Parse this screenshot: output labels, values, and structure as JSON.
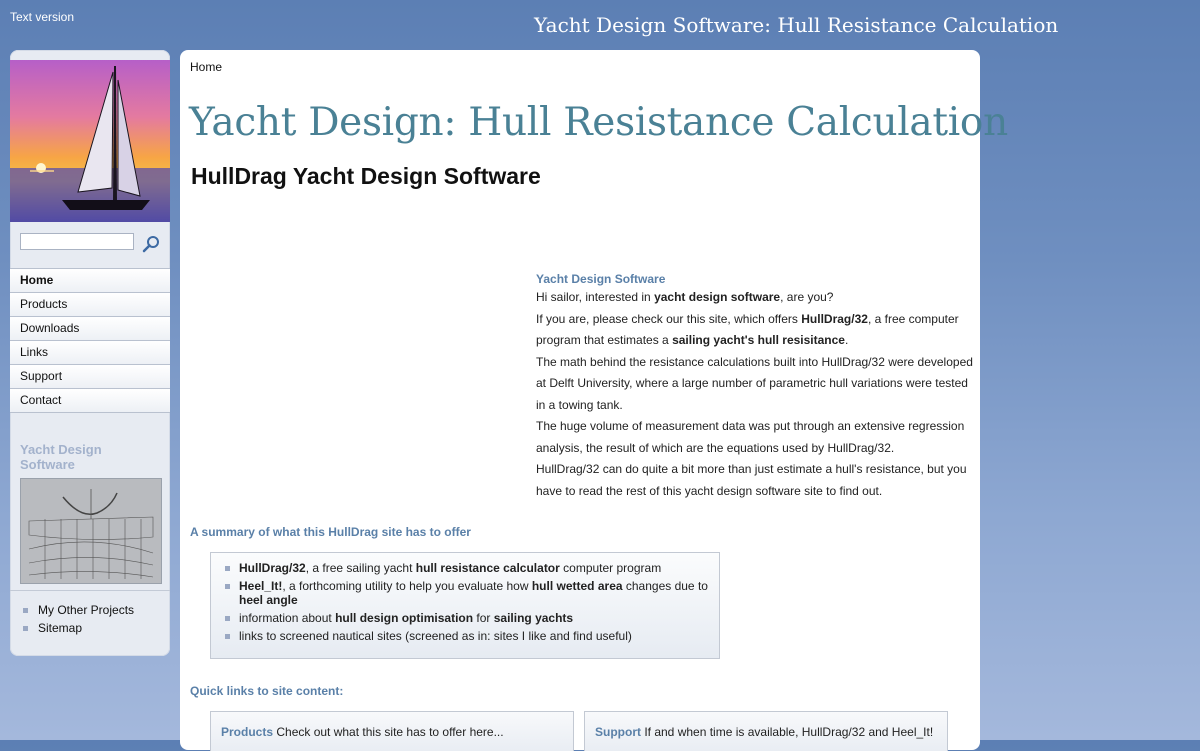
{
  "top": {
    "text_version": "Text version",
    "site_title": "Yacht Design Software: Hull Resistance Calculation"
  },
  "sidebar": {
    "search_placeholder": "",
    "nav": [
      "Home",
      "Products",
      "Downloads",
      "Links",
      "Support",
      "Contact"
    ],
    "heading": "Yacht Design Software",
    "links": [
      "My Other Projects",
      "Sitemap"
    ]
  },
  "main": {
    "breadcrumb": "Home",
    "title": "Yacht Design: Hull Resistance Calculation",
    "subtitle": "HullDrag Yacht Design Software",
    "intro": {
      "heading": "Yacht Design Software",
      "p1_a": "Hi sailor, interested in ",
      "p1_b": "yacht design software",
      "p1_c": ", are you?",
      "p2_a": "If you are, please check our this site, which offers ",
      "p2_b": "HullDrag/32",
      "p2_c": ", a free computer program that estimates a ",
      "p2_d": "sailing yacht's hull resisitance",
      "p2_e": ".",
      "p3": "The math behind the resistance calculations built into HullDrag/32 were developed at Delft University, where a large number of parametric hull variations were tested in a towing tank.",
      "p4": "The huge volume of measurement data was put through an extensive regression analysis, the result of which are the equations used by HullDrag/32.",
      "p5": "HullDrag/32 can do quite a bit more than just estimate a hull's resistance, but you have to read the rest of this yacht design software site to find out."
    },
    "summary_heading": "A summary of what this HullDrag site has to offer",
    "summary": {
      "i1_a": "HullDrag/32",
      "i1_b": ", a free sailing yacht ",
      "i1_c": "hull resistance calculator",
      "i1_d": " computer program",
      "i2_a": "Heel_It!",
      "i2_b": ", a forthcoming utility to help you evaluate how ",
      "i2_c": "hull wetted area",
      "i2_d": " changes due to ",
      "i2_e": "heel angle",
      "i3_a": "information about ",
      "i3_b": "hull design optimisation",
      "i3_c": " for ",
      "i3_d": "sailing yachts",
      "i4": "links to screened nautical sites (screened as in: sites I like and find useful)"
    },
    "quick_heading": "Quick links to site content:",
    "quick": [
      {
        "label": "Products",
        "text": " Check out what this site has to offer here..."
      },
      {
        "label": "Support",
        "text": " If and when time is available, HullDrag/32 and Heel_It!"
      }
    ]
  }
}
